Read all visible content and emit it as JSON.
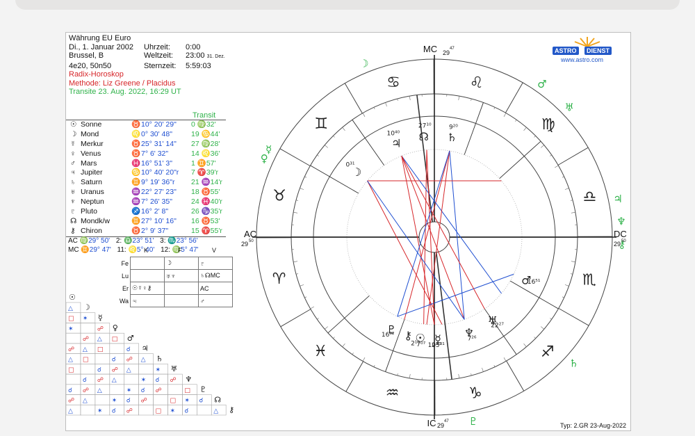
{
  "header": {
    "line1": "Währung EU Euro",
    "date": "Di., 1. Januar 2002",
    "city": "Brussel, B",
    "coords": "4e20, 50n50",
    "uhrzeit_label": "Uhrzeit:",
    "uhrzeit_value": "0:00",
    "weltzeit_label": "Weltzeit:",
    "weltzeit_value": "23:00",
    "weltzeit_note": "31. Dez.",
    "sternzeit_label": "Sternzeit:",
    "sternzeit_value": "5:59:03",
    "chart_type": "Radix-Horoskop",
    "method": "Methode: Liz Greene / Placidus",
    "transit_line": "Transite 23. Aug. 2022, 16:29 UT"
  },
  "transit_header": "Transit",
  "planets": [
    {
      "glyph": "☉",
      "name": "Sonne",
      "sign": "♉",
      "pos": "10° 20' 29\"",
      "transit": "0 ♍32'"
    },
    {
      "glyph": "☽",
      "name": "Mond",
      "sign": "♌",
      "pos": "0° 30' 48\"",
      "transit": "19 ♋44'"
    },
    {
      "glyph": "☿",
      "name": "Merkur",
      "sign": "♉",
      "pos": "25° 31' 14\"",
      "transit": "27 ♍28'"
    },
    {
      "glyph": "♀",
      "name": "Venus",
      "sign": "♉",
      "pos": "7° 6' 32\"",
      "transit": "14 ♌36'"
    },
    {
      "glyph": "♂",
      "name": "Mars",
      "sign": "♓",
      "pos": "16° 51' 3\"",
      "transit": "1 ♊57'"
    },
    {
      "glyph": "♃",
      "name": "Jupiter",
      "sign": "♋",
      "pos": "10° 40' 20\"r",
      "transit": "7 ♈39'r"
    },
    {
      "glyph": "♄",
      "name": "Saturn",
      "sign": "♊",
      "pos": "9° 19' 36\"r",
      "transit": "21 ♒14'r"
    },
    {
      "glyph": "♅",
      "name": "Uranus",
      "sign": "♒",
      "pos": "22° 27' 23\"",
      "transit": "18 ♉55'"
    },
    {
      "glyph": "♆",
      "name": "Neptun",
      "sign": "♒",
      "pos": "7° 26' 35\"",
      "transit": "24 ♓40'r"
    },
    {
      "glyph": "♇",
      "name": "Pluto",
      "sign": "♐",
      "pos": "16° 2' 8\"",
      "transit": "26 ♑35'r"
    },
    {
      "glyph": "☊",
      "name": "Mondk/w",
      "sign": "♊",
      "pos": "27° 10' 16\"",
      "transit": "16 ♉53'"
    },
    {
      "glyph": "⚷",
      "name": "Chiron",
      "sign": "♉",
      "pos": "2° 9' 37\"",
      "transit": "15 ♈55'r"
    }
  ],
  "cusps": {
    "row1": [
      "AC",
      "♍29° 50'",
      "2:",
      "♎23° 51'",
      "3:",
      "♏23° 56'"
    ],
    "row2": [
      "MC",
      "♊29° 47'",
      "11:",
      "♌5° 40'",
      "12:",
      "♍5° 47'"
    ]
  },
  "elements": {
    "heads": [
      "K",
      "F",
      "V"
    ],
    "rows": [
      {
        "label": "Fe",
        "k": "",
        "f": "☽",
        "v": "♇"
      },
      {
        "label": "Lu",
        "k": "",
        "f": "♅♆",
        "v": "♄☊MC"
      },
      {
        "label": "Er",
        "k": "☉☿♀⚷",
        "f": "",
        "v": "AC"
      },
      {
        "label": "Wa",
        "k": "♃",
        "f": "",
        "v": "♂"
      }
    ]
  },
  "wheel": {
    "mc_label": "MC",
    "mc_deg": "29",
    "mc_min": "47",
    "ic_label": "IC",
    "ic_deg": "29",
    "ic_min": "47",
    "ac_label": "AC",
    "ac_deg": "29",
    "ac_min": "50",
    "dc_label": "DC",
    "dc_deg": "29",
    "dc_min": "50",
    "signs": [
      "♋",
      "♊",
      "♉",
      "♈",
      "♓",
      "♒",
      "♑",
      "♐",
      "♏",
      "♎",
      "♍",
      "♌"
    ],
    "inner_labels": [
      "10⁴⁰",
      "27¹⁰",
      "9²⁰",
      "0³¹",
      "16⁵¹",
      "22²⁷",
      "7²⁶",
      "16⁰²",
      "25³¹",
      "2¹⁰",
      "7⁰⁷",
      "10²⁰"
    ]
  },
  "logo": {
    "brand1": "ASTRO",
    "brand2": "DIENST",
    "url": "www.astro.com"
  },
  "footer": "Typ: 2.GR  23-Aug-2022",
  "colors": {
    "red": "#d6262a",
    "blue": "#1f4fd1",
    "green": "#2fb24a"
  }
}
